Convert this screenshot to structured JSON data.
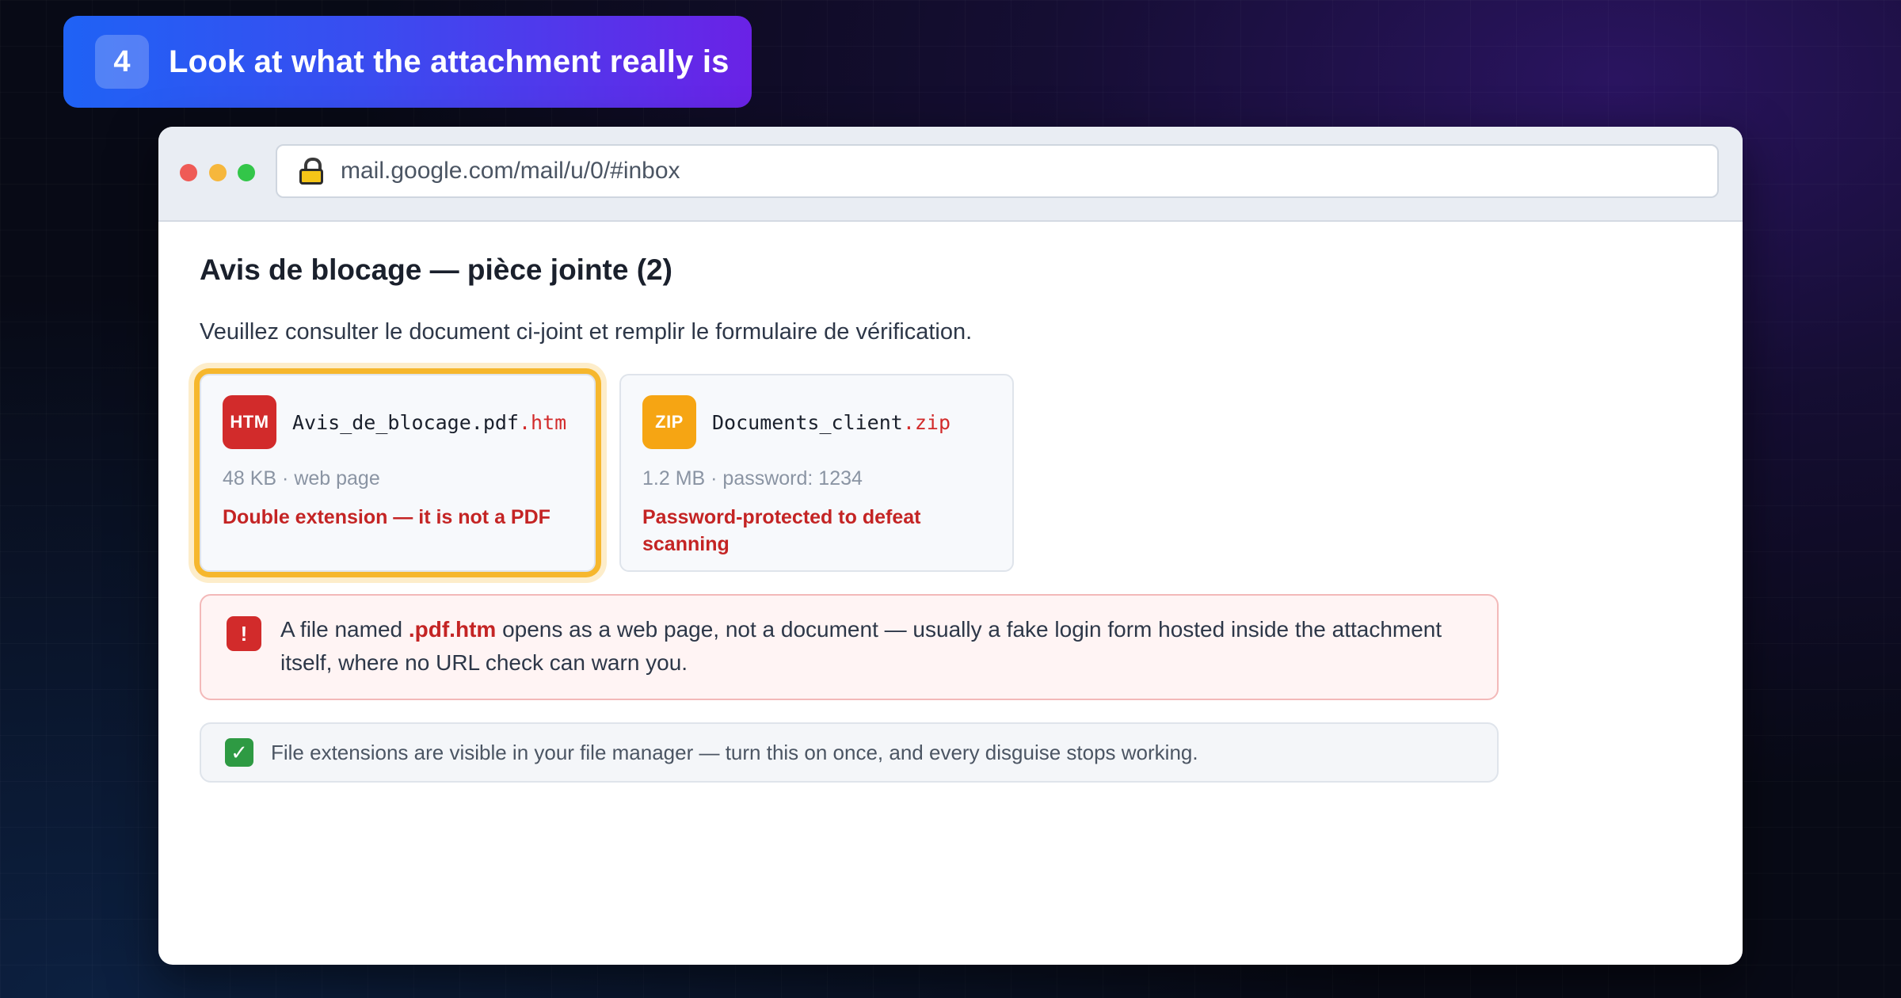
{
  "step": {
    "number": "4",
    "title": "Look at what the attachment really is"
  },
  "browser": {
    "url": "mail.google.com/mail/u/0/#inbox",
    "icons": {
      "lock": "lock-icon"
    }
  },
  "email": {
    "subject": "Avis de blocage — pièce jointe (2)",
    "body": "Veuillez consulter le document ci-joint et remplir le formulaire de vérification."
  },
  "attachments": [
    {
      "icon_label": "HTM",
      "name_base": "Avis_de_blocage.pdf",
      "name_ext": ".htm",
      "meta": "48 KB · web page",
      "warning": "Double extension — it is not a PDF",
      "flagged": true,
      "icon_color": "#d22b2b"
    },
    {
      "icon_label": "ZIP",
      "name_base": "Documents_client",
      "name_ext": ".zip",
      "meta": "1.2 MB · password: 1234",
      "warning": "Password-protected to defeat scanning",
      "flagged": false,
      "icon_color": "#f6a513"
    }
  ],
  "alert": {
    "icon": "!",
    "text_before": "A file named ",
    "highlight": ".pdf.htm",
    "text_after": " opens as a web page, not a document — usually a fake login form hosted inside the attachment itself, where no URL check can warn you."
  },
  "tip": {
    "icon": "✓",
    "text": "File extensions are visible in your file manager — turn this on once, and every disguise stops working."
  },
  "colors": {
    "highlight_ring": "#f6b72d",
    "danger": "#c42424",
    "success": "#2e9a43"
  }
}
